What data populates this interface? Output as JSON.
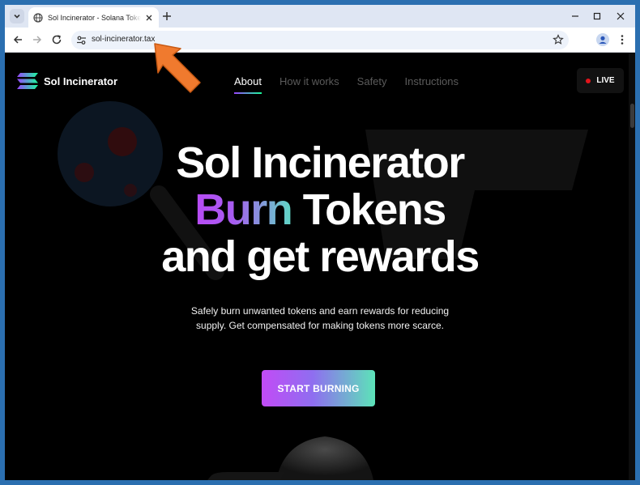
{
  "browser": {
    "tab_title": "Sol Incinerator - Solana Token Burn",
    "url": "sol-incinerator.tax"
  },
  "site": {
    "brand": "Sol Incinerator",
    "nav": [
      {
        "label": "About",
        "active": true
      },
      {
        "label": "How it works",
        "active": false
      },
      {
        "label": "Safety",
        "active": false
      },
      {
        "label": "Instructions",
        "active": false
      }
    ],
    "live_label": "LIVE",
    "hero": {
      "line1": "Sol Incinerator",
      "line2_highlight": "Burn",
      "line2_rest": " Tokens",
      "line3": "and get rewards"
    },
    "subtitle": "Safely burn unwanted tokens and earn rewards for reducing supply. Get compensated for making tokens more scarce.",
    "cta": "START BURNING"
  },
  "colors": {
    "accent_purple": "#9945ff",
    "accent_green": "#19fb9b",
    "live_dot": "#e2141b",
    "annotation_arrow": "#f07a2e"
  }
}
